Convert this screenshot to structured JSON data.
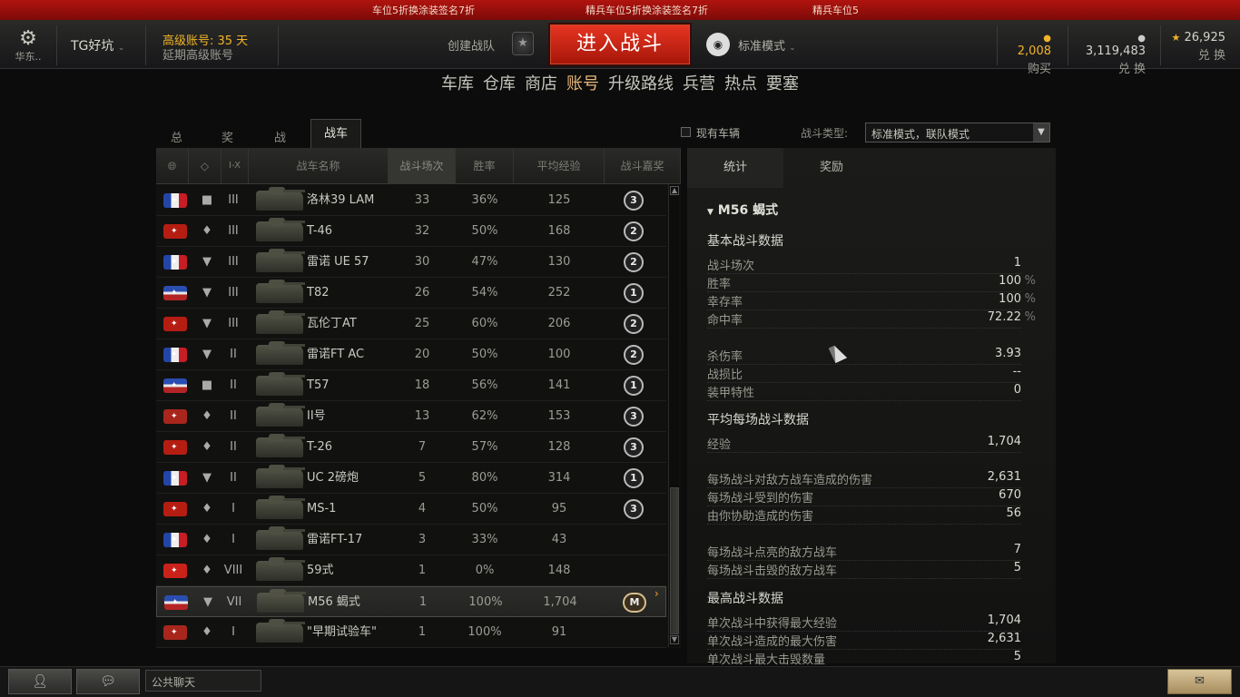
{
  "ticker": [
    "车位5折换涂装签名7折",
    "精兵车位5折换涂装签名7折",
    "精兵车位5"
  ],
  "header": {
    "settings_label": "华东..",
    "nickname": "TG好坑",
    "premium_line1": "高级账号:  35 天",
    "premium_line2": "延期高级账号",
    "platoon_label": "创建战队",
    "battle_button": "进入战斗",
    "mode_label": "标准模式",
    "gold_value": "2,008",
    "gold_label": "购买",
    "credits_value": "3,119,483",
    "credits_label": "兑  换",
    "xp_value": "26,925",
    "xp_label": "兑  换"
  },
  "nav": [
    "车库",
    "仓库",
    "商店",
    "账号",
    "升级路线",
    "兵营",
    "热点",
    "要塞"
  ],
  "nav_active": "账号",
  "subtabs": [
    "总计",
    "奖励",
    "战绩",
    "战车"
  ],
  "filter": {
    "current_vehicles_label": "现有车辆",
    "battle_type_label": "战斗类型:",
    "battle_type_value": "标准模式，联队模式"
  },
  "columns": [
    "I-X",
    "战车名称",
    "战斗场次",
    "胜率",
    "平均经验",
    "战斗嘉奖"
  ],
  "rows": [
    {
      "flag": "fr",
      "cls": "■",
      "tier": "III",
      "name": "洛林39 LAM",
      "battles": "33",
      "win": "36%",
      "xp": "125",
      "mark": "3"
    },
    {
      "flag": "ru",
      "cls": "♦",
      "tier": "III",
      "name": "T-46",
      "battles": "32",
      "win": "50%",
      "xp": "168",
      "mark": "2"
    },
    {
      "flag": "fr",
      "cls": "▼",
      "tier": "III",
      "name": "雷诺 UE 57",
      "battles": "30",
      "win": "47%",
      "xp": "130",
      "mark": "2"
    },
    {
      "flag": "us",
      "cls": "▼",
      "tier": "III",
      "name": "T82",
      "battles": "26",
      "win": "54%",
      "xp": "252",
      "mark": "1"
    },
    {
      "flag": "ru",
      "cls": "▼",
      "tier": "III",
      "name": "瓦伦丁AT",
      "battles": "25",
      "win": "60%",
      "xp": "206",
      "mark": "2"
    },
    {
      "flag": "fr",
      "cls": "▼",
      "tier": "II",
      "name": "雷诺FT AC",
      "battles": "20",
      "win": "50%",
      "xp": "100",
      "mark": "2"
    },
    {
      "flag": "us",
      "cls": "■",
      "tier": "II",
      "name": "T57",
      "battles": "18",
      "win": "56%",
      "xp": "141",
      "mark": "1"
    },
    {
      "flag": "de",
      "cls": "♦",
      "tier": "II",
      "name": "II号",
      "battles": "13",
      "win": "62%",
      "xp": "153",
      "mark": "3"
    },
    {
      "flag": "ru",
      "cls": "♦",
      "tier": "II",
      "name": "T-26",
      "battles": "7",
      "win": "57%",
      "xp": "128",
      "mark": "3"
    },
    {
      "flag": "fr",
      "cls": "▼",
      "tier": "II",
      "name": "UC 2磅炮",
      "battles": "5",
      "win": "80%",
      "xp": "314",
      "mark": "1"
    },
    {
      "flag": "ru",
      "cls": "♦",
      "tier": "I",
      "name": "MS-1",
      "battles": "4",
      "win": "50%",
      "xp": "95",
      "mark": "3"
    },
    {
      "flag": "fr",
      "cls": "♦",
      "tier": "I",
      "name": "雷诺FT-17",
      "battles": "3",
      "win": "33%",
      "xp": "43",
      "mark": ""
    },
    {
      "flag": "cn",
      "cls": "♦",
      "tier": "VIII",
      "name": "59式",
      "battles": "1",
      "win": "0%",
      "xp": "148",
      "mark": ""
    },
    {
      "flag": "us",
      "cls": "▼",
      "tier": "VII",
      "name": "M56 蝎式",
      "battles": "1",
      "win": "100%",
      "xp": "1,704",
      "mark": "M"
    },
    {
      "flag": "de",
      "cls": "♦",
      "tier": "I",
      "name": "\"早期试验车\"",
      "battles": "1",
      "win": "100%",
      "xp": "91",
      "mark": ""
    }
  ],
  "selected_row": 13,
  "right": {
    "tab_stats": "统计",
    "tab_awards": "奖励",
    "tank_name": "M56 蝎式",
    "basic_header": "基本战斗数据",
    "basic": [
      {
        "label": "战斗场次",
        "value": "1",
        "unit": ""
      },
      {
        "label": "胜率",
        "value": "100",
        "unit": "%"
      },
      {
        "label": "幸存率",
        "value": "100",
        "unit": "%"
      },
      {
        "label": "命中率",
        "value": "72.22",
        "unit": "%"
      },
      {
        "label": "杀伤率",
        "value": "3.93",
        "unit": ""
      },
      {
        "label": "战损比",
        "value": "--",
        "unit": ""
      },
      {
        "label": "装甲特性",
        "value": "0",
        "unit": ""
      }
    ],
    "avg_header": "平均每场战斗数据",
    "avg": [
      {
        "label": "经验",
        "value": "1,704"
      },
      {
        "label": "每场战斗对敌方战车造成的伤害",
        "value": "2,631"
      },
      {
        "label": "每场战斗受到的伤害",
        "value": "670"
      },
      {
        "label": "由你协助造成的伤害",
        "value": "56"
      },
      {
        "label": "每场战斗点亮的敌方战车",
        "value": "7"
      },
      {
        "label": "每场战斗击毁的敌方战车",
        "value": "5"
      }
    ],
    "max_header": "最高战斗数据",
    "max": [
      {
        "label": "单次战斗中获得最大经验",
        "value": "1,704"
      },
      {
        "label": "单次战斗造成的最大伤害",
        "value": "2,631"
      },
      {
        "label": "单次战斗最大击毁数量",
        "value": "5"
      }
    ]
  },
  "bottom": {
    "chat_label": "公共聊天"
  },
  "icons": [
    "gear-icon",
    "platoon-icon",
    "mode-icon",
    "gold-icon",
    "credits-icon",
    "xp-star-icon",
    "globe-icon",
    "class-icon",
    "contacts-icon",
    "chat-icon"
  ]
}
